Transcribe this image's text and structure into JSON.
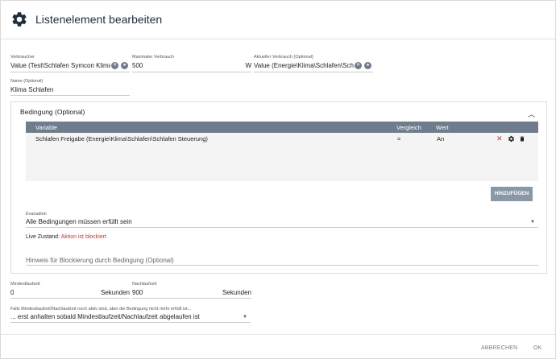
{
  "header": {
    "title": "Listenelement bearbeiten",
    "icon": "gear-icon"
  },
  "fields": {
    "verbraucher": {
      "label": "Verbraucher",
      "value": "Value (Test\\Schlafen Symcon Klima)"
    },
    "max_verbrauch": {
      "label": "Maximaler Verbrauch",
      "value": "500",
      "unit": "W"
    },
    "aktueller_verbrauch": {
      "label": "Aktueller Verbrauch (Optional)",
      "value": "Value (Energie\\Klima\\Schlafen\\Sch"
    },
    "name": {
      "label": "Name (Optional)",
      "value": "Klima Schlafen"
    }
  },
  "condition": {
    "title": "Bedingung (Optional)",
    "columns": {
      "variable": "Variable",
      "vergleich": "Vergleich",
      "wert": "Wert"
    },
    "rows": [
      {
        "variable": "Schlafen Freigabe (Energie\\Klima\\Schlafen\\Schlafen Steuerung)",
        "vergleich": "=",
        "wert": "An"
      }
    ],
    "add_label": "HINZUFÜGEN",
    "evaluation": {
      "label": "Evaluation",
      "value": "Alle Bedingungen müssen erfüllt sein"
    },
    "live_label": "Live Zustand:",
    "live_value": "Aktion ist blockiert",
    "hint_placeholder": "Hinweis für Blockierung durch Bedingung (Optional)"
  },
  "mindestlaufzeit": {
    "label": "Mindestlaufzeit",
    "value": "0",
    "unit": "Sekunden"
  },
  "nachlaufzeit": {
    "label": "Nachlaufzeit",
    "value": "900",
    "unit": "Sekunden"
  },
  "falls": {
    "label": "Falls Mindestlaufzeit/Nachlaufzeit noch aktiv sind, aber die Bedingung nicht mehr erfüllt ist...",
    "value": "... erst anhalten sobald Mindestlaufzeit/Nachlaufzeit abgelaufen ist"
  },
  "footer": {
    "cancel": "ABBRECHEN",
    "ok": "OK"
  },
  "colors": {
    "accent": "#6f7c8c",
    "danger": "#c0392b"
  }
}
